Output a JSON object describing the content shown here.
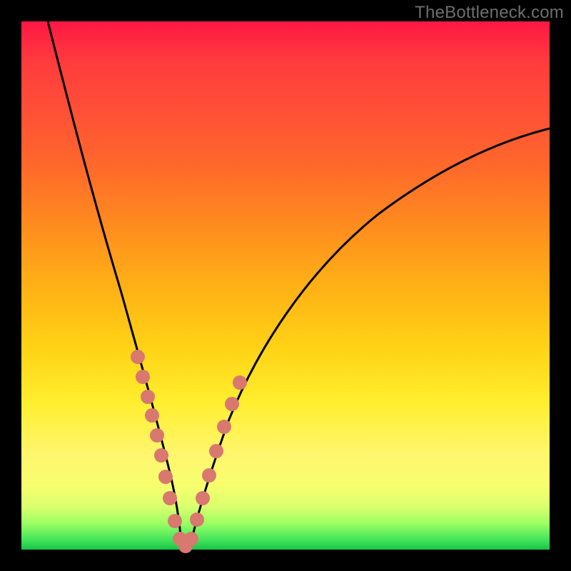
{
  "watermark": "TheBottleneck.com",
  "chart_data": {
    "type": "line",
    "title": "",
    "xlabel": "",
    "ylabel": "",
    "xlim": [
      0,
      100
    ],
    "ylim": [
      0,
      100
    ],
    "grid": false,
    "series": [
      {
        "name": "curve",
        "x": [
          5,
          8,
          12,
          16,
          20,
          23,
          25,
          27,
          29,
          31,
          33,
          36,
          40,
          46,
          54,
          64,
          76,
          90,
          100
        ],
        "y": [
          100,
          86,
          70,
          54,
          38,
          26,
          18,
          10,
          4,
          2,
          4,
          10,
          20,
          32,
          46,
          58,
          68,
          76,
          80
        ]
      }
    ],
    "scatter_points": {
      "name": "markers",
      "x": [
        20.5,
        21.5,
        22.3,
        23.0,
        23.8,
        24.6,
        25.4,
        26.3,
        27.5,
        28.7,
        30.0,
        31.2,
        32.0,
        33.0,
        34.0,
        35.3,
        36.5,
        37.5,
        38.5
      ],
      "y": [
        35.0,
        31.5,
        28.0,
        25.0,
        22.0,
        18.5,
        15.0,
        11.5,
        6.0,
        3.0,
        2.0,
        3.0,
        6.0,
        10.0,
        14.0,
        18.0,
        22.0,
        25.5,
        28.5
      ]
    },
    "marker_color": "#d8786e",
    "curve_color": "#000000"
  }
}
